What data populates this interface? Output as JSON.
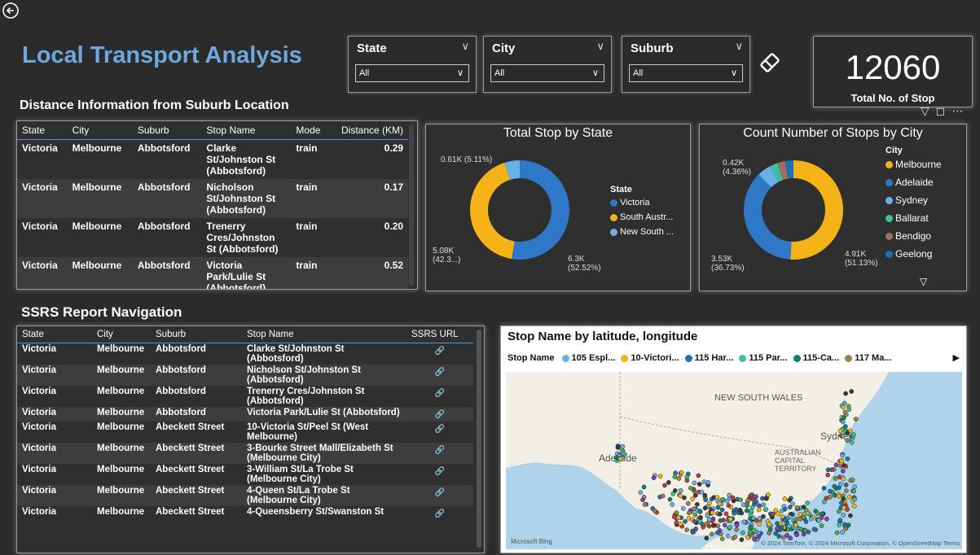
{
  "header": {
    "back_icon": "back-arrow-icon",
    "title": "Local Transport Analysis"
  },
  "slicers": [
    {
      "label": "State",
      "value": "All"
    },
    {
      "label": "City",
      "value": "All"
    },
    {
      "label": "Suburb",
      "value": "All"
    }
  ],
  "kpi": {
    "value": "12060",
    "label": "Total No. of Stop"
  },
  "distance_table": {
    "heading": "Distance Information from Suburb Location",
    "columns": [
      "State",
      "City",
      "Suburb",
      "Stop Name",
      "Mode",
      "Distance (KM)"
    ],
    "rows": [
      [
        "Victoria",
        "Melbourne",
        "Abbotsford",
        "Clarke St/Johnston St (Abbotsford)",
        "train",
        "0.29"
      ],
      [
        "Victoria",
        "Melbourne",
        "Abbotsford",
        "Nicholson St/Johnston St (Abbotsford)",
        "train",
        "0.17"
      ],
      [
        "Victoria",
        "Melbourne",
        "Abbotsford",
        "Trenerry Cres/Johnston St (Abbotsford)",
        "train",
        "0.20"
      ],
      [
        "Victoria",
        "Melbourne",
        "Abbotsford",
        "Victoria Park/Lulie St (Abbotsford)",
        "train",
        "0.52"
      ]
    ]
  },
  "state_chart": {
    "title": "Total Stop by State",
    "legend_title": "State",
    "legend": [
      {
        "name": "Victoria",
        "color": "#2e78c7"
      },
      {
        "name": "South Austr...",
        "color": "#f6b317"
      },
      {
        "name": "New South ...",
        "color": "#6ab0e8"
      }
    ],
    "labels": [
      "0.61K (5.11%)",
      "5.08K\n(42.3...)",
      "6.3K\n(52.52%)"
    ]
  },
  "city_chart": {
    "title": "Count Number of Stops by City",
    "legend_title": "City",
    "legend": [
      {
        "name": "Melbourne",
        "color": "#f6b317"
      },
      {
        "name": "Adelaide",
        "color": "#2e78c7"
      },
      {
        "name": "Sydney",
        "color": "#6ab0e8"
      },
      {
        "name": "Ballarat",
        "color": "#3fbfa0"
      },
      {
        "name": "Bendigo",
        "color": "#a0705a"
      },
      {
        "name": "Geelong",
        "color": "#1f6fb5"
      }
    ],
    "labels": [
      "0.42K\n(4.36%)",
      "3.53K\n(36.73%)",
      "4.91K\n(51.13%)"
    ]
  },
  "ssrs_table": {
    "heading": "SSRS Report Navigation",
    "columns": [
      "State",
      "City",
      "Suburb",
      "Stop Name",
      "SSRS URL"
    ],
    "rows": [
      [
        "Victoria",
        "Melbourne",
        "Abbotsford",
        "Clarke St/Johnston St (Abbotsford)"
      ],
      [
        "Victoria",
        "Melbourne",
        "Abbotsford",
        "Nicholson St/Johnston St (Abbotsford)"
      ],
      [
        "Victoria",
        "Melbourne",
        "Abbotsford",
        "Trenerry Cres/Johnston St (Abbotsford)"
      ],
      [
        "Victoria",
        "Melbourne",
        "Abbotsford",
        "Victoria Park/Lulie St (Abbotsford)"
      ],
      [
        "Victoria",
        "Melbourne",
        "Abeckett Street",
        "10-Victoria St/Peel St (West Melbourne)"
      ],
      [
        "Victoria",
        "Melbourne",
        "Abeckett Street",
        "3-Bourke Street Mall/Elizabeth St (Melbourne City)"
      ],
      [
        "Victoria",
        "Melbourne",
        "Abeckett Street",
        "3-William St/La Trobe St (Melbourne City)"
      ],
      [
        "Victoria",
        "Melbourne",
        "Abeckett Street",
        "4-Queen St/La Trobe St (Melbourne City)"
      ],
      [
        "Victoria",
        "Melbourne",
        "Abeckett Street",
        "4-Queensberry St/Swanston St"
      ]
    ]
  },
  "map": {
    "title": "Stop Name by latitude, longitude",
    "legend_title": "Stop Name",
    "legend": [
      {
        "name": "105 Espl...",
        "color": "#6ab0e8"
      },
      {
        "name": "10-Victori...",
        "color": "#f6b317"
      },
      {
        "name": "115 Har...",
        "color": "#1f6fb5"
      },
      {
        "name": "115 Par...",
        "color": "#3fbfa0"
      },
      {
        "name": "115-Ca...",
        "color": "#118070"
      },
      {
        "name": "117 Ma...",
        "color": "#a08050"
      }
    ],
    "region_labels": [
      "NEW SOUTH WALES",
      "Adelaide",
      "AUSTRALIAN CAPITAL TERRITORY",
      "Sydney"
    ],
    "bing": "Microsoft Bing",
    "attribution": "© 2024 TomTom, © 2024 Microsoft Corporation, © OpenStreetMap  Terms"
  }
}
